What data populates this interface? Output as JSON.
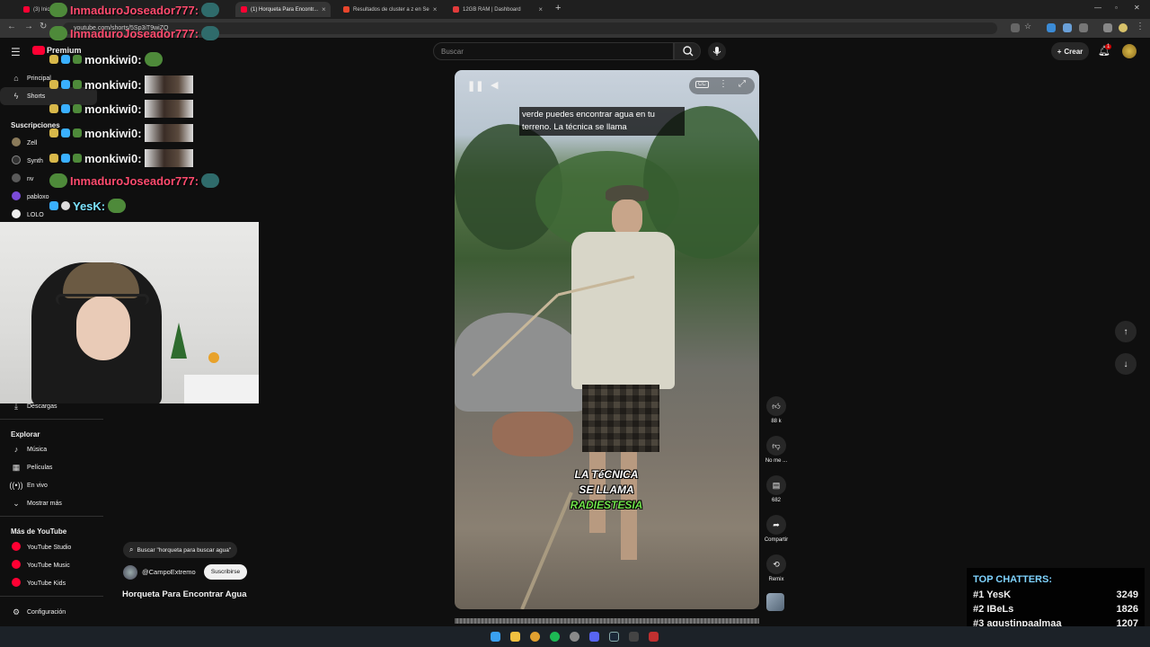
{
  "browser": {
    "tabs": [
      {
        "label": "(3) Inicio",
        "active": false
      },
      {
        "label": "(1) Horqueta Para Encontr...",
        "active": true
      },
      {
        "label": "Resultados de cluster a z en Se",
        "active": false
      },
      {
        "label": "12GB RAM | Dashboard",
        "active": false
      }
    ],
    "new_tab": "+",
    "url": "youtube.com/shorts/5Sp3iT9wiZQ"
  },
  "youtube": {
    "logo_text": "Premium",
    "search_placeholder": "Buscar",
    "create_label": "Crear",
    "notif_count": "1",
    "sidebar": {
      "items_top": [
        {
          "label": "Principal",
          "icon": "home-icon"
        },
        {
          "label": "Shorts",
          "icon": "shorts-icon"
        }
      ],
      "subs_title": "Suscripciones",
      "subs": [
        {
          "label": "Zell",
          "color": "#8a7a5a"
        },
        {
          "label": "Synth",
          "color": "#333333"
        },
        {
          "label": "nv",
          "color": "#5a5a5a"
        },
        {
          "label": "pabloxo",
          "color": "#7b4bd8"
        },
        {
          "label": "LOLO",
          "color": "#eeeeee"
        }
      ],
      "downloads": "Descargas",
      "explore_title": "Explorar",
      "explore": [
        {
          "label": "Música",
          "icon": "music-icon"
        },
        {
          "label": "Películas",
          "icon": "film-icon"
        },
        {
          "label": "En vivo",
          "icon": "live-icon"
        },
        {
          "label": "Mostrar más",
          "icon": "chevron-down-icon"
        }
      ],
      "more_title": "Más de YouTube",
      "more": [
        {
          "label": "YouTube Studio"
        },
        {
          "label": "YouTube Music"
        },
        {
          "label": "YouTube Kids"
        }
      ],
      "settings": "Configuración"
    },
    "short": {
      "caption": "verde puedes encontrar agua en tu terreno. La técnica se llama",
      "overlay_lines": [
        "LA TéCNICA",
        "SE LLAMA",
        "RADIESTESIA"
      ],
      "overlay_color_white": "#ffffff",
      "overlay_color_green": "#6fe04a",
      "search_chip": "Buscar \"horqueta para buscar agua\"",
      "channel": "@CampoExtremo",
      "subscribe": "Suscribirse",
      "title": "Horqueta Para Encontrar Agua",
      "likes": "88 k",
      "dislike_label": "No me ...",
      "comments": "682",
      "share_label": "Compartir",
      "remix_label": "Remix"
    }
  },
  "stream": {
    "chat": [
      {
        "user": "InmaduroJoseador777:",
        "color": "#ff4b6e"
      },
      {
        "user": "InmaduroJoseador777:",
        "color": "#ff4b6e"
      },
      {
        "user": "monkiwi0:",
        "color": "#ffffff"
      },
      {
        "user": "monkiwi0:",
        "color": "#ffffff"
      },
      {
        "user": "monkiwi0:",
        "color": "#ffffff"
      },
      {
        "user": "monkiwi0:",
        "color": "#ffffff"
      },
      {
        "user": "monkiwi0:",
        "color": "#ffffff"
      },
      {
        "user": "InmaduroJoseador777:",
        "color": "#ff4b6e"
      },
      {
        "user": "YesK:",
        "color": "#7ce3ff"
      }
    ],
    "top_chatters": {
      "title": "TOP CHATTERS:",
      "rows": [
        {
          "rank": "#1",
          "name": "YesK",
          "count": "3249"
        },
        {
          "rank": "#2",
          "name": "IBeLs",
          "count": "1826"
        },
        {
          "rank": "#3",
          "name": "agustinpaalmaa",
          "count": "1207"
        }
      ]
    }
  },
  "colors": {
    "youtube_red": "#ff0033",
    "background": "#0f0f0f",
    "top_chatters_title": "#7fd3ff"
  }
}
